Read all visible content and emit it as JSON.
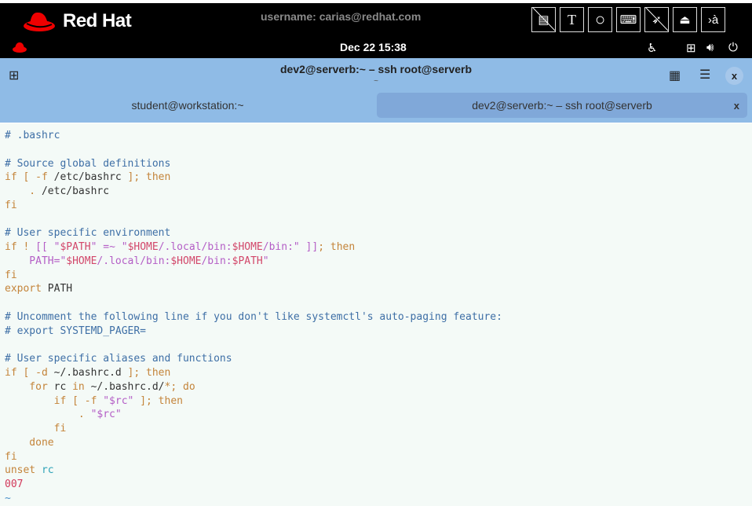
{
  "banner": {
    "brand": "Red Hat",
    "username": "username: carias@redhat.com",
    "tools": [
      "notes-off",
      "text",
      "circle",
      "keyboard",
      "pointer-off",
      "user",
      "input-method"
    ],
    "input_label": "›à"
  },
  "panel": {
    "datetime": "Dec 22  15:38"
  },
  "window": {
    "title": "dev2@serverb:~ – ssh root@serverb",
    "subtitle": "~"
  },
  "tabs": [
    {
      "label": "student@workstation:~"
    },
    {
      "label": "dev2@serverb:~ – ssh root@serverb",
      "active": true
    }
  ],
  "colors": {
    "comment": "#3e6fa6",
    "keyword": "#c4843a",
    "string": "#b45ec6",
    "header": "#8fbbe6"
  },
  "terminal": {
    "lines": [
      [
        [
          "# .bashrc",
          "c"
        ]
      ],
      [],
      [
        [
          "# Source global definitions",
          "c"
        ]
      ],
      [
        [
          "if [ -f ",
          "k"
        ],
        [
          "/etc/bashrc ",
          "n"
        ],
        [
          "]; then",
          "k"
        ]
      ],
      [
        [
          "    . ",
          "k"
        ],
        [
          "/etc/bashrc",
          "n"
        ]
      ],
      [
        [
          "fi",
          "k"
        ]
      ],
      [],
      [
        [
          "# User specific environment",
          "c"
        ]
      ],
      [
        [
          "if ! ",
          "k"
        ],
        [
          "[[ ",
          "s"
        ],
        [
          "\"",
          "s"
        ],
        [
          "$PATH",
          "v"
        ],
        [
          "\" =~ \"",
          "s"
        ],
        [
          "$HOME",
          "v"
        ],
        [
          "/.local/bin:",
          "s"
        ],
        [
          "$HOME",
          "v"
        ],
        [
          "/bin:\" ]]",
          "s"
        ],
        [
          "; then",
          "k"
        ]
      ],
      [
        [
          "    PATH=\"",
          "s"
        ],
        [
          "$HOME",
          "v"
        ],
        [
          "/.local/bin:",
          "s"
        ],
        [
          "$HOME",
          "v"
        ],
        [
          "/bin:",
          "s"
        ],
        [
          "$PATH",
          "v"
        ],
        [
          "\"",
          "s"
        ]
      ],
      [
        [
          "fi",
          "k"
        ]
      ],
      [
        [
          "export ",
          "k"
        ],
        [
          "PATH",
          "n"
        ]
      ],
      [],
      [
        [
          "# Uncomment the following line if you don't like systemctl's auto-paging feature:",
          "c"
        ]
      ],
      [
        [
          "# export SYSTEMD_PAGER=",
          "c"
        ]
      ],
      [],
      [
        [
          "# User specific aliases and functions",
          "c"
        ]
      ],
      [
        [
          "if [ -d ",
          "k"
        ],
        [
          "~/.bashrc.d ",
          "n"
        ],
        [
          "]; then",
          "k"
        ]
      ],
      [
        [
          "    for ",
          "k"
        ],
        [
          "rc ",
          "n"
        ],
        [
          "in ",
          "k"
        ],
        [
          "~/.bashrc.d/",
          "n"
        ],
        [
          "*; do",
          "k"
        ]
      ],
      [
        [
          "        if [ -f ",
          "k"
        ],
        [
          "\"$rc\"",
          "s"
        ],
        [
          " ]; then",
          "k"
        ]
      ],
      [
        [
          "            . ",
          "k"
        ],
        [
          "\"$rc\"",
          "s"
        ]
      ],
      [
        [
          "        fi",
          "k"
        ]
      ],
      [
        [
          "    done",
          "k"
        ]
      ],
      [
        [
          "fi",
          "k"
        ]
      ],
      [
        [
          "unset ",
          "k"
        ],
        [
          "rc",
          "t"
        ]
      ],
      [
        [
          "007",
          "r"
        ]
      ],
      [
        [
          "~",
          "b"
        ]
      ]
    ]
  }
}
